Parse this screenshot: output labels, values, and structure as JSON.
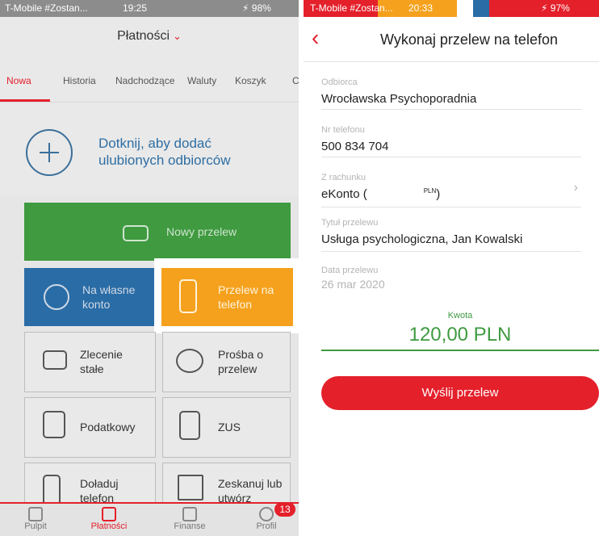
{
  "left": {
    "status": {
      "carrier": "T-Mobile #Zostan...",
      "time": "19:25",
      "battery": "98%"
    },
    "title": "Płatności",
    "tabs": [
      "Nowa",
      "Historia",
      "Nadchodzące",
      "Waluty",
      "Koszyk",
      "C"
    ],
    "favorite_text": "Dotknij, aby dodać ulubionych odbiorców",
    "tiles": {
      "new_transfer": "Nowy przelew",
      "own_account": "Na własne konto",
      "phone_transfer": "Przelew na telefon",
      "standing_order": "Zlecenie stałe",
      "request": "Prośba o przelew",
      "tax": "Podatkowy",
      "zus": "ZUS",
      "topup": "Doładuj telefon",
      "scan": "Zeskanuj lub utwórz"
    },
    "bottom_nav": [
      "Pulpit",
      "Płatności",
      "Finanse",
      "Profil"
    ],
    "badge": "13"
  },
  "right": {
    "status": {
      "carrier": "T-Mobile #Zostan...",
      "time": "20:33",
      "battery": "97%"
    },
    "title": "Wykonaj przelew na telefon",
    "fields": {
      "recipient_label": "Odbiorca",
      "recipient_value": "Wrocławska Psychoporadnia",
      "phone_label": "Nr telefonu",
      "phone_value": "500 834 704",
      "account_label": "Z rachunku",
      "account_value_prefix": "eKonto (",
      "account_currency": "PLN",
      "account_value_suffix": ")",
      "title_label": "Tytuł przelewu",
      "title_value": "Usługa psychologiczna, Jan Kowalski",
      "date_label": "Data przelewu",
      "date_value": "26 mar 2020"
    },
    "amount_label": "Kwota",
    "amount_value": "120,00 PLN",
    "send_label": "Wyślij przelew"
  }
}
